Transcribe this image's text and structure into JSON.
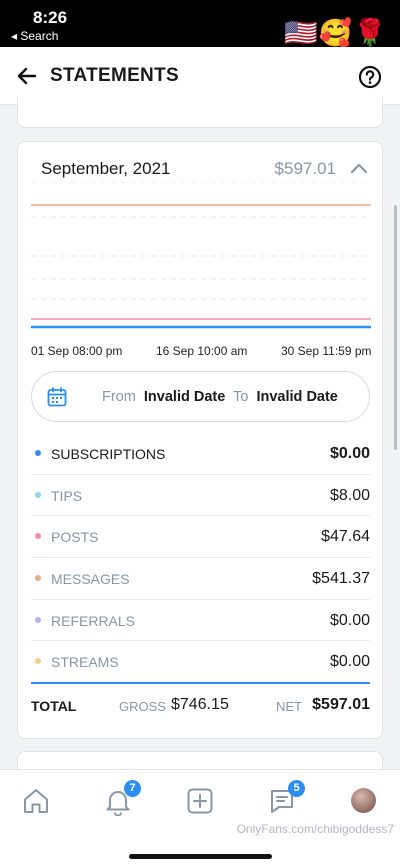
{
  "status_bar": {
    "time": "8:26",
    "back_link": "◂ Search",
    "emoji": "🇺🇸🥰🌹"
  },
  "header": {
    "title": "STATEMENTS"
  },
  "statement": {
    "month": "September, 2021",
    "total": "$597.01",
    "chart_labels": [
      "01 Sep 08:00 pm",
      "16 Sep 10:00 am",
      "30 Sep 11:59 pm"
    ],
    "date_range": {
      "from_label": "From",
      "from_value": "Invalid Date",
      "to_label": "To",
      "to_value": "Invalid Date"
    },
    "rows": [
      {
        "label": "SUBSCRIPTIONS",
        "value": "$0.00",
        "color": "#2d8ef2",
        "active": true
      },
      {
        "label": "TIPS",
        "value": "$8.00",
        "color": "#8fd3e6",
        "active": false
      },
      {
        "label": "POSTS",
        "value": "$47.64",
        "color": "#ef8fa8",
        "active": false
      },
      {
        "label": "MESSAGES",
        "value": "$541.37",
        "color": "#f4a58f",
        "active": false
      },
      {
        "label": "REFERRALS",
        "value": "$0.00",
        "color": "#b8b2e6",
        "active": false
      },
      {
        "label": "STREAMS",
        "value": "$0.00",
        "color": "#f5cd8a",
        "active": false
      }
    ],
    "totals": {
      "label": "TOTAL",
      "gross_label": "GROSS",
      "gross_value": "$746.15",
      "net_label": "NET",
      "net_value": "$597.01"
    }
  },
  "bottom_nav": {
    "notifications_badge": "7",
    "messages_badge": "5"
  },
  "watermark": "OnlyFans.com/chibigoddess7",
  "colors": {
    "accent": "#2d8ef2",
    "muted": "#8a96a3"
  }
}
